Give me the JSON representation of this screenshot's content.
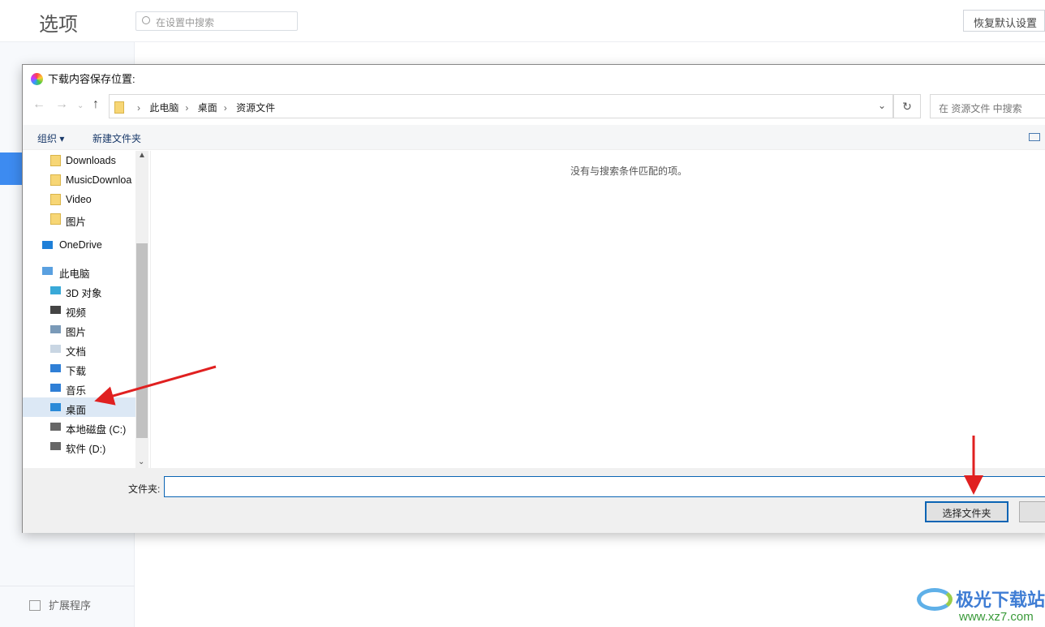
{
  "page": {
    "title": "选项",
    "search_placeholder": "在设置中搜索",
    "restore_label": "恢复默认设置",
    "sidebar_bottom": "扩展程序"
  },
  "dialog": {
    "title": "下载内容保存位置:",
    "breadcrumb": [
      "此电脑",
      "桌面",
      "资源文件"
    ],
    "search_placeholder": "在 资源文件 中搜索",
    "toolbar": {
      "organize": "组织 ▾",
      "new_folder": "新建文件夹"
    },
    "tree": [
      {
        "label": "Downloads",
        "icon": "folder-icon"
      },
      {
        "label": "MusicDownloa",
        "icon": "folder-icon"
      },
      {
        "label": "Video",
        "icon": "folder-icon"
      },
      {
        "label": "图片",
        "icon": "folder-icon"
      },
      {
        "label": "OneDrive",
        "icon": "cloud-icon"
      },
      {
        "label": "此电脑",
        "icon": "computer-icon"
      },
      {
        "label": "3D 对象",
        "icon": "cube-icon"
      },
      {
        "label": "视频",
        "icon": "video-icon"
      },
      {
        "label": "图片",
        "icon": "picture-icon"
      },
      {
        "label": "文档",
        "icon": "document-icon"
      },
      {
        "label": "下载",
        "icon": "download-icon"
      },
      {
        "label": "音乐",
        "icon": "music-icon"
      },
      {
        "label": "桌面",
        "icon": "desktop-icon",
        "selected": true
      },
      {
        "label": "本地磁盘 (C:)",
        "icon": "drive-icon"
      },
      {
        "label": "软件 (D:)",
        "icon": "drive-icon"
      }
    ],
    "empty_message": "没有与搜索条件匹配的项。",
    "folder_label": "文件夹:",
    "folder_value": "",
    "select_button": "选择文件夹"
  },
  "watermark": {
    "name": "极光下载站",
    "url": "www.xz7.com"
  },
  "colors": {
    "accent": "#0a64b4",
    "annotation_arrow": "#e02020"
  }
}
